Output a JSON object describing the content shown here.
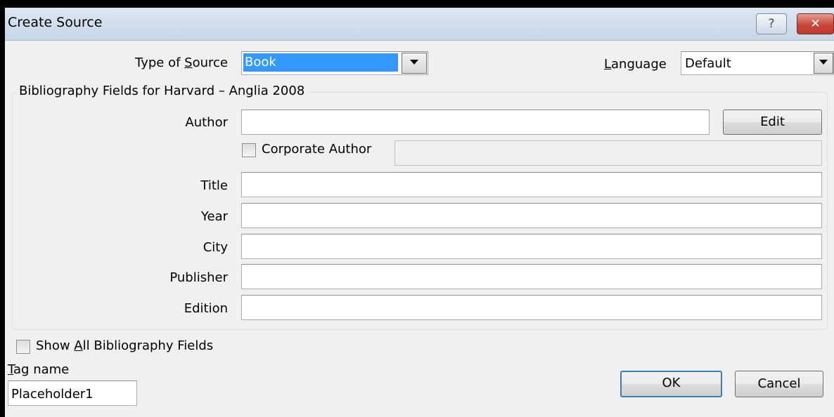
{
  "window": {
    "title": "Create Source",
    "help_glyph": "?",
    "close_glyph": "✕"
  },
  "type_of_source": {
    "label": "Type of Source",
    "label_pre": "Type of ",
    "label_key": "S",
    "label_post": "ource",
    "value": "Book"
  },
  "language": {
    "label": "Language",
    "label_key": "L",
    "label_post": "anguage",
    "value": "Default"
  },
  "group": {
    "legend": "Bibliography Fields for Harvard – Anglia 2008"
  },
  "fields": {
    "author": {
      "label": "Author",
      "value": ""
    },
    "edit_button": "Edit",
    "corporate_author": {
      "label": "Corporate Author",
      "checked": false,
      "value": ""
    },
    "title": {
      "label": "Title",
      "value": ""
    },
    "year": {
      "label": "Year",
      "value": ""
    },
    "city": {
      "label": "City",
      "value": ""
    },
    "publisher": {
      "label": "Publisher",
      "value": ""
    },
    "edition": {
      "label": "Edition",
      "value": ""
    }
  },
  "show_all": {
    "label": "Show All Bibliography Fields",
    "label_pre": "Show ",
    "label_key": "A",
    "label_post": "ll Bibliography Fields",
    "checked": false
  },
  "tag_name": {
    "label": "Tag name",
    "label_key": "T",
    "label_post": "ag name",
    "value": "Placeholder1"
  },
  "buttons": {
    "ok": "OK",
    "cancel": "Cancel"
  },
  "colors": {
    "selection": "#3399ff",
    "dialog_bg": "#f0f0f0",
    "close_red": "#c6473a",
    "default_button_border": "#3c7fb1"
  }
}
